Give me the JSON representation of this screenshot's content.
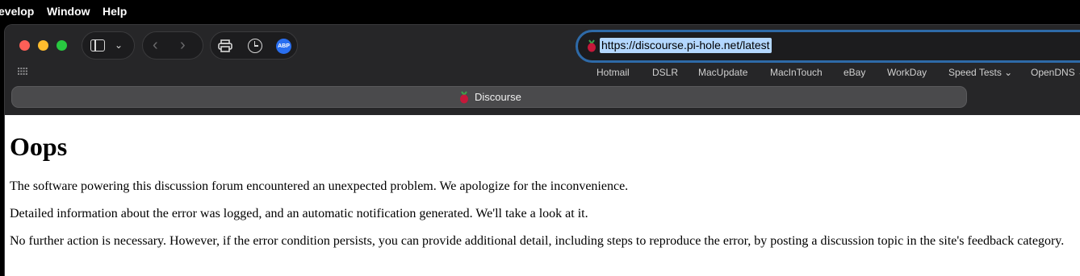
{
  "menubar": {
    "items": [
      "evelop",
      "Window",
      "Help"
    ]
  },
  "browser": {
    "url": "https://discourse.pi-hole.net/latest",
    "abp_label": "ABP",
    "bookmarks": [
      "Hotmail",
      "DSLR",
      "MacUpdate",
      "MacInTouch",
      "eBay",
      "WorkDay",
      "Speed Tests ⌄",
      "OpenDNS ⌄"
    ],
    "tab_title": "Discourse",
    "icons": {
      "sidebar": "sidebar-icon",
      "nav_back": "chevron-left-icon",
      "nav_forward": "chevron-right-icon",
      "print": "print-icon",
      "history": "clock-icon",
      "adblock": "abp-icon",
      "favicon": "raspberry-icon"
    }
  },
  "page": {
    "heading": "Oops",
    "paragraphs": [
      "The software powering this discussion forum encountered an unexpected problem. We apologize for the inconvenience.",
      "Detailed information about the error was logged, and an automatic notification generated. We'll take a look at it.",
      "No further action is necessary. However, if the error condition persists, you can provide additional detail, including steps to reproduce the error, by posting a discussion topic in the site's feedback category."
    ]
  },
  "colors": {
    "red": "#fe5f57",
    "yellow": "#febc2e",
    "green": "#28c840",
    "url_highlight": "#b3d7ff",
    "address_focus": "#2e6aa8"
  }
}
